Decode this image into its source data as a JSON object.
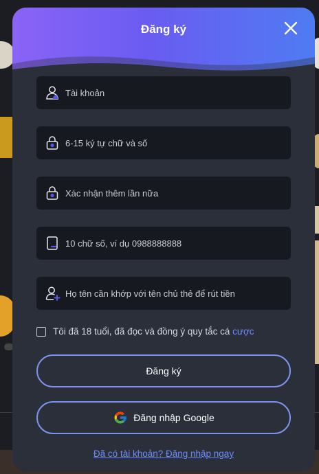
{
  "modal": {
    "title": "Đăng ký",
    "fields": [
      {
        "placeholder": "Tài khoản",
        "icon": "user-icon"
      },
      {
        "placeholder": "6-15 ký tự chữ và số",
        "icon": "lock-icon"
      },
      {
        "placeholder": "Xác nhận thêm lần nữa",
        "icon": "lock-icon"
      },
      {
        "placeholder": "10 chữ số, ví dụ 0988888888",
        "icon": "phone-icon"
      },
      {
        "placeholder": "Họ tên cần khớp với tên chủ thẻ để rút tiền",
        "icon": "add-user-icon"
      }
    ],
    "agree": {
      "checked": false,
      "text": "Tôi đã 18 tuổi, đã đọc và đồng ý quy tắc cá ",
      "link": "cược"
    },
    "register_button": "Đăng ký",
    "google_button": "Đăng nhập Google",
    "login_link": "Đã có tài khoản? Đăng nhập ngay"
  },
  "colors": {
    "accent": "#6c8cff",
    "header_gradient_start": "#8b63f7",
    "header_gradient_end": "#4f7bf2",
    "modal_bg": "#2a2f3a",
    "field_bg": "#161920"
  }
}
